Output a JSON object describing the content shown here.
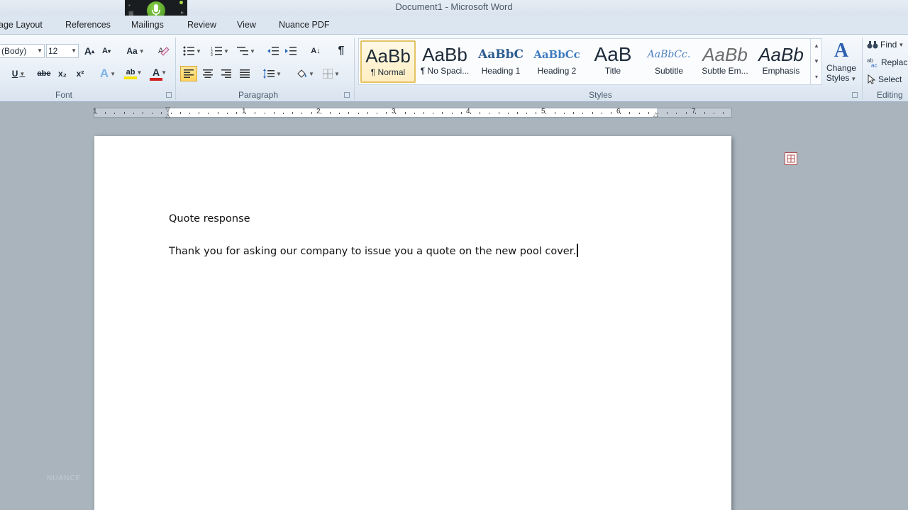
{
  "window": {
    "title": "Document1  -  Microsoft Word"
  },
  "tabs": [
    "age Layout",
    "References",
    "Mailings",
    "Review",
    "View",
    "Nuance PDF"
  ],
  "font_group": {
    "label": "Font",
    "font_name": "(Body)",
    "font_size": "12",
    "grow_font": "A",
    "shrink_font": "A",
    "change_case": "Aa",
    "underline": "U",
    "strikethrough": "abe",
    "subscript": "x₂",
    "superscript": "x²",
    "text_effects": "A",
    "highlight": "ab",
    "font_color": "A"
  },
  "paragraph_group": {
    "label": "Paragraph",
    "sort": "A↓",
    "show_marks": "¶"
  },
  "styles_group": {
    "label": "Styles",
    "items": [
      {
        "sample": "AaBb",
        "label": "¶ Normal",
        "selected": true
      },
      {
        "sample": "AaBb",
        "label": "¶ No Spaci..."
      },
      {
        "sample": "AaBbC",
        "label": "Heading 1"
      },
      {
        "sample": "AaBbCc",
        "label": "Heading 2"
      },
      {
        "sample": "AaB",
        "label": "Title"
      },
      {
        "sample": "AaBbCc.",
        "label": "Subtitle"
      },
      {
        "sample": "AaBb",
        "label": "Subtle Em..."
      },
      {
        "sample": "AaBb",
        "label": "Emphasis"
      }
    ],
    "change_styles_line1": "Change",
    "change_styles_line2": "Styles",
    "change_styles_icon": "A"
  },
  "editing_group": {
    "label": "Editing",
    "find": "Find",
    "replace": "Replac",
    "select": "Select"
  },
  "ruler": {
    "numbers": [
      "1",
      "1",
      "2",
      "3",
      "4",
      "5",
      "6",
      "7"
    ]
  },
  "document": {
    "heading": "Quote response",
    "body": "Thank you for asking our company to issue you a quote on the new pool cover."
  },
  "watermark": "NUANCE",
  "colors": {
    "accent_green": "#5aa92b",
    "highlight_yellow": "#f5e300",
    "font_red": "#d02020",
    "selected_style_border": "#e5c365"
  }
}
